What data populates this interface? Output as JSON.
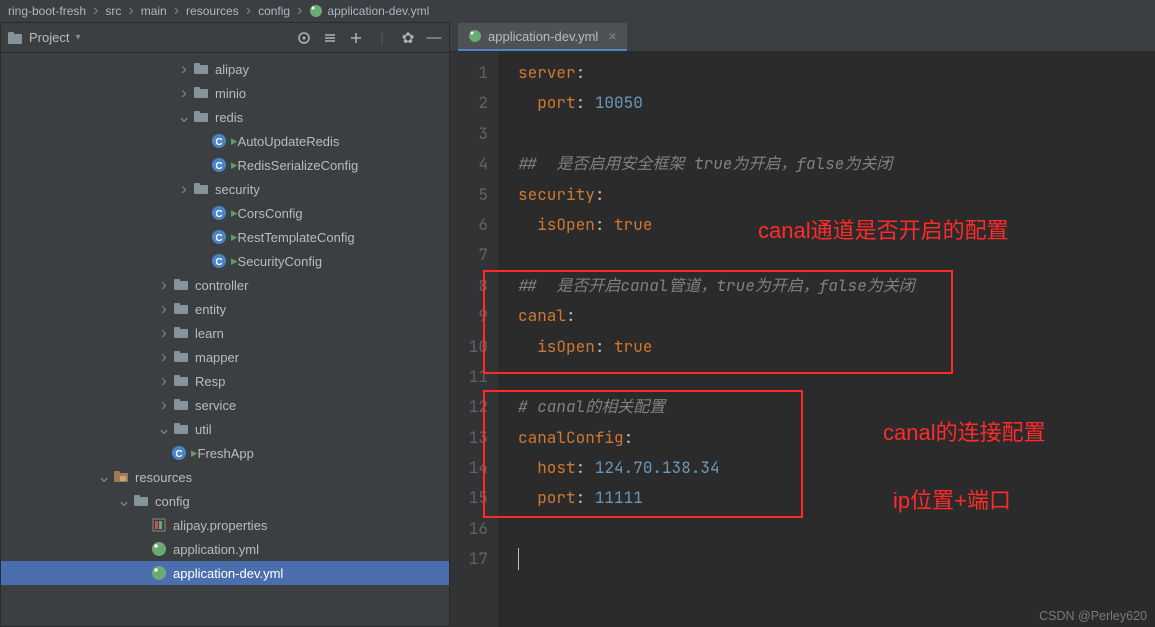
{
  "breadcrumb": [
    "ring-boot-fresh",
    "src",
    "main",
    "resources",
    "config",
    "application-dev.yml"
  ],
  "project": {
    "label": "Project"
  },
  "tree": {
    "alipay": "alipay",
    "minio": "minio",
    "redis": "redis",
    "autoRedis": "AutoUpdateRedis",
    "redisSer": "RedisSerializeConfig",
    "security": "security",
    "cors": "CorsConfig",
    "restTpl": "RestTemplateConfig",
    "secCfg": "SecurityConfig",
    "controller": "controller",
    "entity": "entity",
    "learn": "learn",
    "mapper": "mapper",
    "resp": "Resp",
    "service": "service",
    "util": "util",
    "freshApp": "FreshApp",
    "resources": "resources",
    "config": "config",
    "alipayProp": "alipay.properties",
    "appYml": "application.yml",
    "appDevYml": "application-dev.yml"
  },
  "tab": {
    "name": "application-dev.yml"
  },
  "code": {
    "l1a": "server",
    "l1b": ":",
    "l2a": "port",
    "l2b": ": ",
    "l2c": "10050",
    "l4": "##  是否启用安全框架 true为开启，false为关闭",
    "l5a": "security",
    "l5b": ":",
    "l6a": "isOpen",
    "l6b": ": ",
    "l6c": "true",
    "l8": "##  是否开启canal管道，true为开启，false为关闭",
    "l9a": "canal",
    "l9b": ":",
    "l10a": "isOpen",
    "l10b": ": ",
    "l10c": "true",
    "l12": "# canal的相关配置",
    "l13a": "canalConfig",
    "l13b": ":",
    "l14a": "host",
    "l14b": ": ",
    "l14c": "124.70.138.34",
    "l15a": "port",
    "l15b": ": ",
    "l15c": "11111"
  },
  "lines": [
    "1",
    "2",
    "3",
    "4",
    "5",
    "6",
    "7",
    "8",
    "9",
    "10",
    "11",
    "12",
    "13",
    "14",
    "15",
    "16",
    "17"
  ],
  "anno": {
    "a1": "canal通道是否开启的配置",
    "a2": "canal的连接配置",
    "a3": "ip位置+端口"
  },
  "watermark": "CSDN @Perley620"
}
